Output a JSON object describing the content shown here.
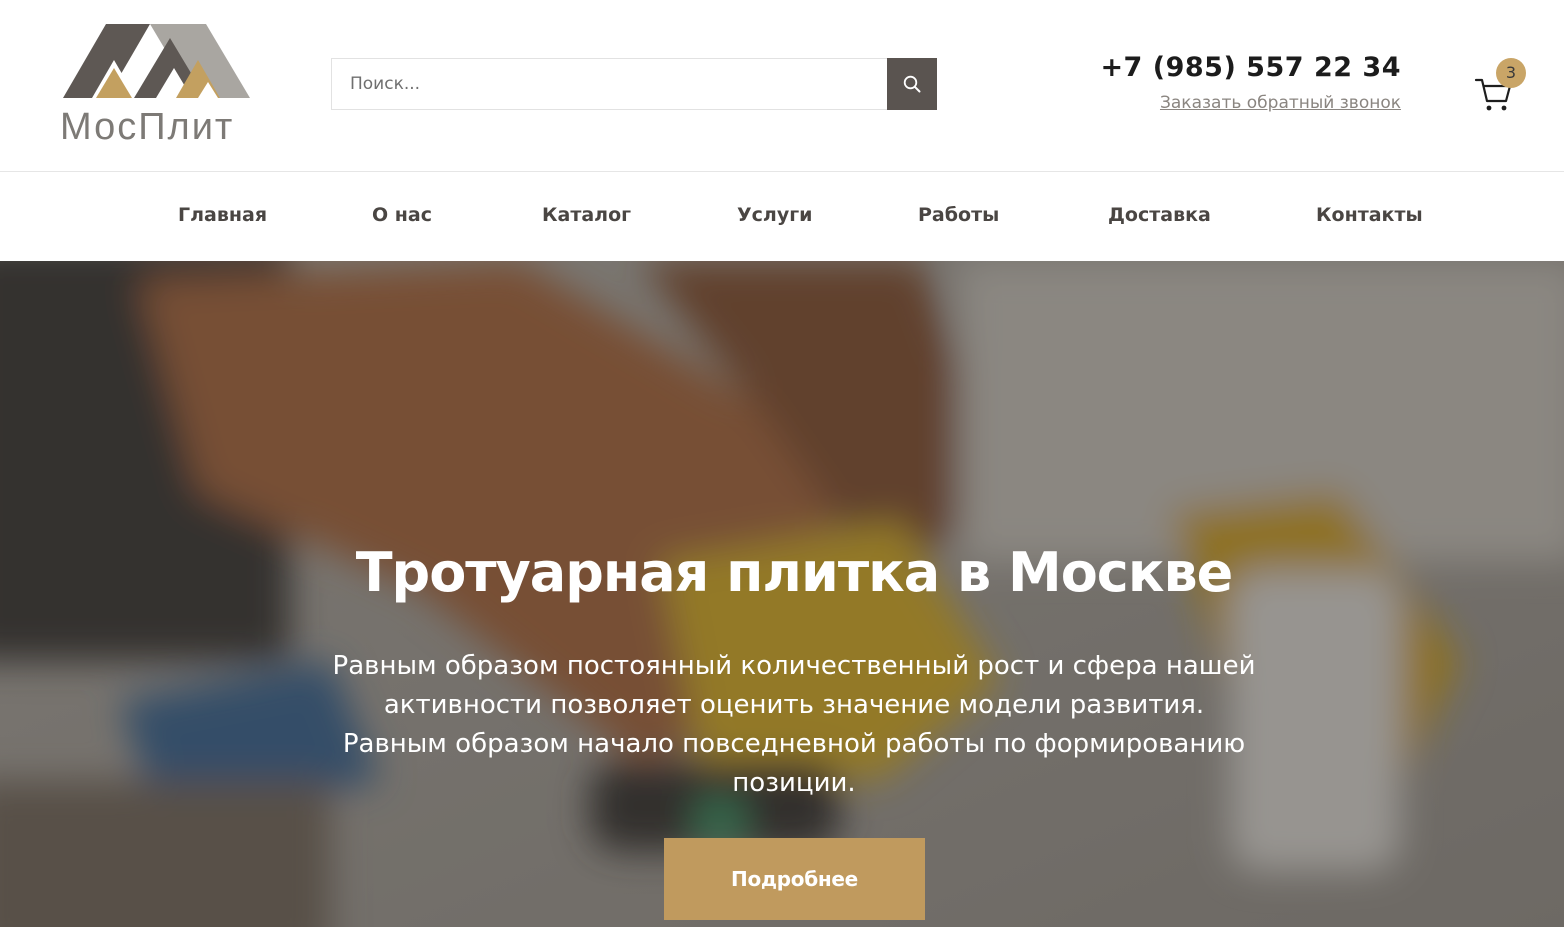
{
  "header": {
    "logo_text": "МосПлит",
    "search": {
      "placeholder": "Поиск..."
    },
    "phone": "+7 (985) 557 22 34",
    "callback_link": "Заказать обратный звонок",
    "cart_count": "3"
  },
  "nav": {
    "items": [
      {
        "label": "Главная"
      },
      {
        "label": "О нас"
      },
      {
        "label": "Каталог"
      },
      {
        "label": "Услуги"
      },
      {
        "label": "Работы"
      },
      {
        "label": "Доставка"
      },
      {
        "label": "Контакты"
      }
    ]
  },
  "hero": {
    "title": "Тротуарная плитка в Москве",
    "text": "Равным образом постоянный количественный рост и сфера нашей активности позволяет оценить значение модели развития. Равным образом начало повседневной работы по формированию позиции.",
    "button_label": "Подробнее"
  },
  "colors": {
    "accent": "#c09a5e",
    "badge": "#c9a567",
    "search_button": "#5a5450",
    "logo_dark": "#5e5854",
    "logo_gold": "#c3a060",
    "logo_grey": "#a9a6a1"
  },
  "icons": {
    "search": "search-icon",
    "cart": "cart-icon"
  }
}
